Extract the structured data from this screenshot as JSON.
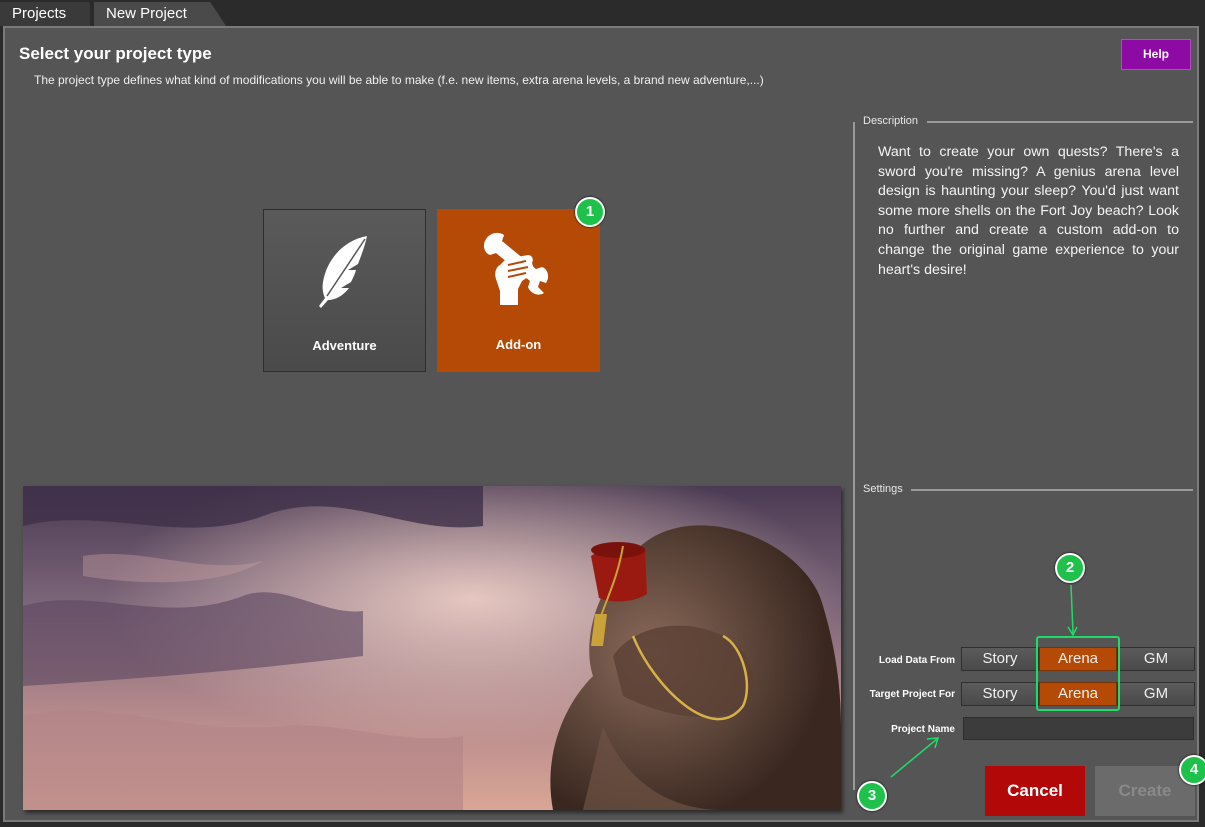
{
  "tabs": [
    {
      "label": "Projects"
    },
    {
      "label": "New Project"
    }
  ],
  "header": {
    "title": "Select your project type",
    "subtitle": "The project type defines what kind of modifications you will be able to make (f.e. new items, extra arena levels, a brand new adventure,...)",
    "help_label": "Help"
  },
  "project_types": [
    {
      "label": "Adventure",
      "icon": "feather-icon",
      "selected": false
    },
    {
      "label": "Add-on",
      "icon": "wrench-fist-icon",
      "selected": true
    }
  ],
  "description": {
    "group_title": "Description",
    "text": "Want to create your own quests? There's a sword you're missing? A genius arena level design is haunting your sleep? You'd just want some more shells on the Fort Joy beach? Look no further and create a custom add-on to change the original game experience to your heart's desire!"
  },
  "settings": {
    "group_title": "Settings",
    "load_data_from": {
      "label": "Load Data From",
      "options": [
        "Story",
        "Arena",
        "GM"
      ],
      "selected": "Arena"
    },
    "target_project_for": {
      "label": "Target Project For",
      "options": [
        "Story",
        "Arena",
        "GM"
      ],
      "selected": "Arena"
    },
    "project_name": {
      "label": "Project Name",
      "value": ""
    }
  },
  "actions": {
    "cancel_label": "Cancel",
    "create_label": "Create"
  },
  "annotations": [
    "1",
    "2",
    "3",
    "4"
  ],
  "colors": {
    "accent": "#b44a06",
    "help": "#8e0aa5",
    "cancel": "#b30808",
    "annotation": "#1ec24a"
  }
}
